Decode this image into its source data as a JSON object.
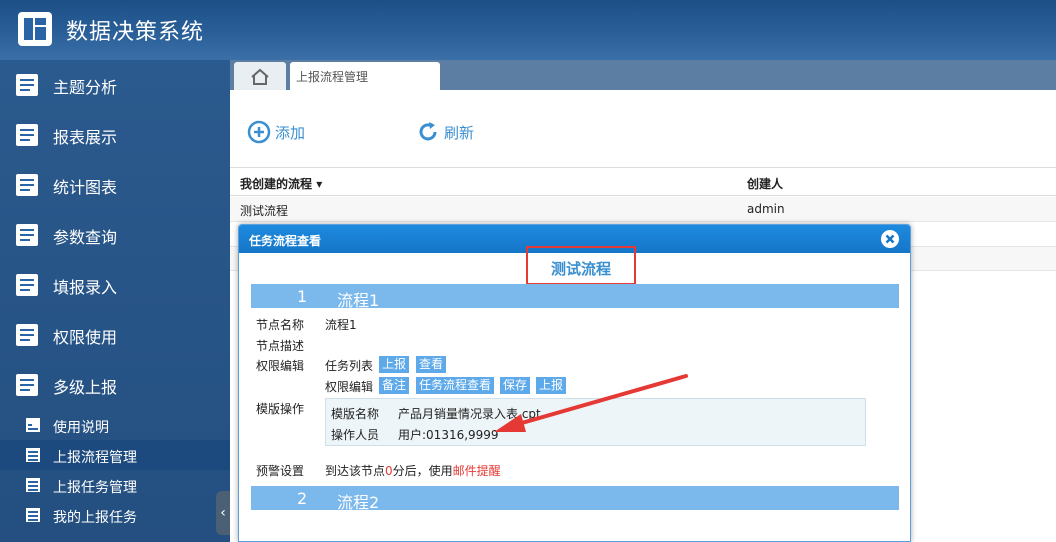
{
  "app": {
    "title": "数据决策系统"
  },
  "sidebar": {
    "items": [
      {
        "label": "主题分析"
      },
      {
        "label": "报表展示"
      },
      {
        "label": "统计图表"
      },
      {
        "label": "参数查询"
      },
      {
        "label": "填报录入"
      },
      {
        "label": "权限使用"
      },
      {
        "label": "多级上报"
      }
    ],
    "subitems": [
      {
        "label": "使用说明"
      },
      {
        "label": "上报流程管理"
      },
      {
        "label": "上报任务管理"
      },
      {
        "label": "我的上报任务"
      }
    ]
  },
  "tabs": {
    "active_label": "上报流程管理"
  },
  "toolbar": {
    "add_label": "添加",
    "refresh_label": "刷新"
  },
  "list": {
    "col_flow": "我创建的流程",
    "col_creator": "创建人",
    "rows": [
      {
        "name": "测试流程",
        "creator": "admin"
      }
    ]
  },
  "dialog": {
    "title": "任务流程查看",
    "flow_name": "测试流程",
    "step1": {
      "num": "1",
      "name": "流程1",
      "labels": {
        "node_name": "节点名称",
        "node_desc": "节点描述",
        "perm_edit": "权限编辑",
        "template_op": "模版操作",
        "warn": "预警设置"
      },
      "node_name_value": "流程1",
      "task_list_label": "任务列表",
      "task_list_buttons": [
        "上报",
        "查看"
      ],
      "perm_list_label": "权限编辑",
      "perm_buttons": [
        "备注",
        "任务流程查看",
        "保存",
        "上报"
      ],
      "template": {
        "name_label": "模版名称",
        "name_value": "产品月销量情况录入表.cpt",
        "operator_label": "操作人员",
        "operator_value": "用户:01316,9999"
      },
      "warn_prefix": "到达该节点",
      "warn_zero": "0",
      "warn_middle": "分后，使用",
      "warn_mail": "邮件提醒"
    },
    "step2": {
      "num": "2",
      "name": "流程2"
    }
  },
  "colors": {
    "accent": "#3a8fd1",
    "highlight_red": "#e53935",
    "step_bar": "#7bb8ec"
  }
}
